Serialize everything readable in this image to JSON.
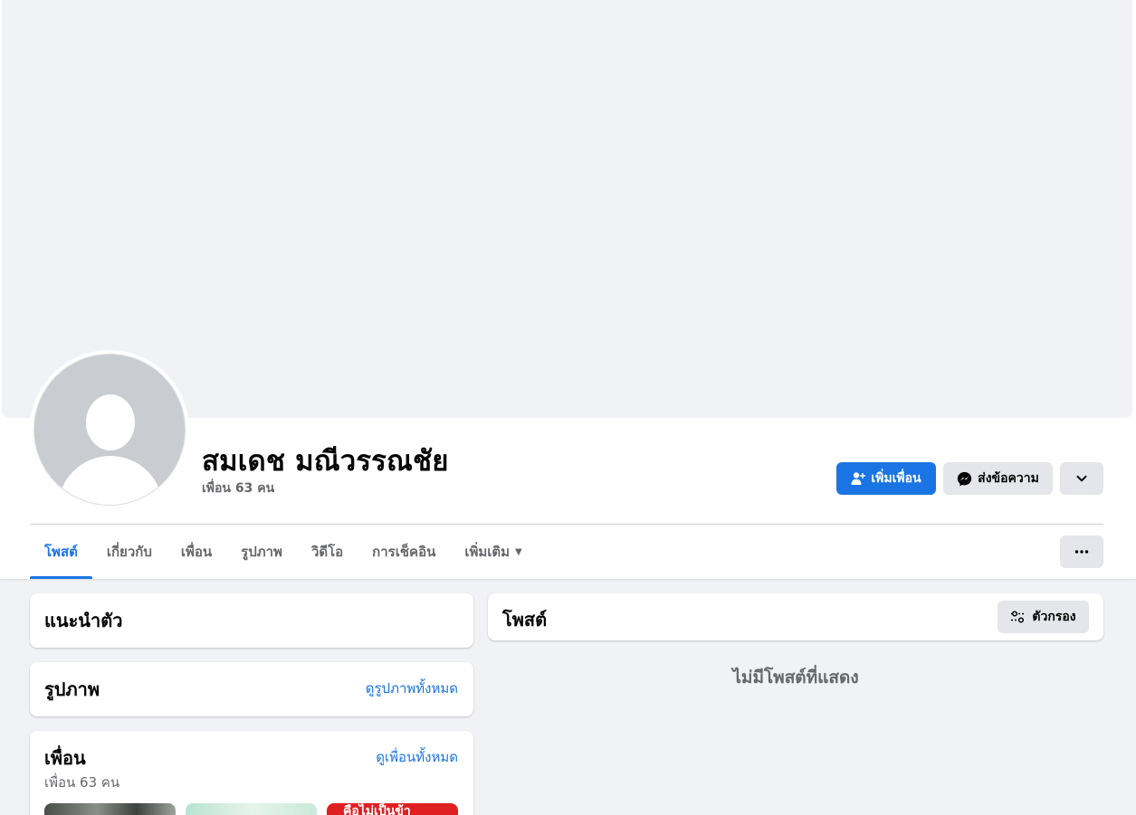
{
  "profile": {
    "name": "สมเดช มณีวรรณชัย",
    "friend_count": "เพื่อน 63 คน"
  },
  "actions": {
    "add_friend": "เพิ่มเพื่อน",
    "message": "ส่งข้อความ"
  },
  "tabs": [
    {
      "label": "โพสต์",
      "active": true
    },
    {
      "label": "เกี่ยวกับ"
    },
    {
      "label": "เพื่อน"
    },
    {
      "label": "รูปภาพ"
    },
    {
      "label": "วิดีโอ"
    },
    {
      "label": "การเช็คอิน"
    },
    {
      "label": "เพิ่มเติม"
    }
  ],
  "intro": {
    "title": "แนะนำตัว"
  },
  "photos": {
    "title": "รูปภาพ",
    "see_all": "ดูรูปภาพทั้งหมด"
  },
  "friends": {
    "title": "เพื่อน",
    "see_all": "ดูเพื่อนทั้งหมด",
    "count": "เพื่อน 63 คน",
    "thumbnail_3_text": "คือไม่เป็นข้า"
  },
  "posts": {
    "title": "โพสต์",
    "filter": "ตัวกรอง",
    "empty": "ไม่มีโพสต์ที่แสดง"
  },
  "colors": {
    "accent": "#1b74e4",
    "background": "#f0f2f5",
    "secondary_button": "#e4e6eb",
    "muted_text": "#65676b"
  }
}
